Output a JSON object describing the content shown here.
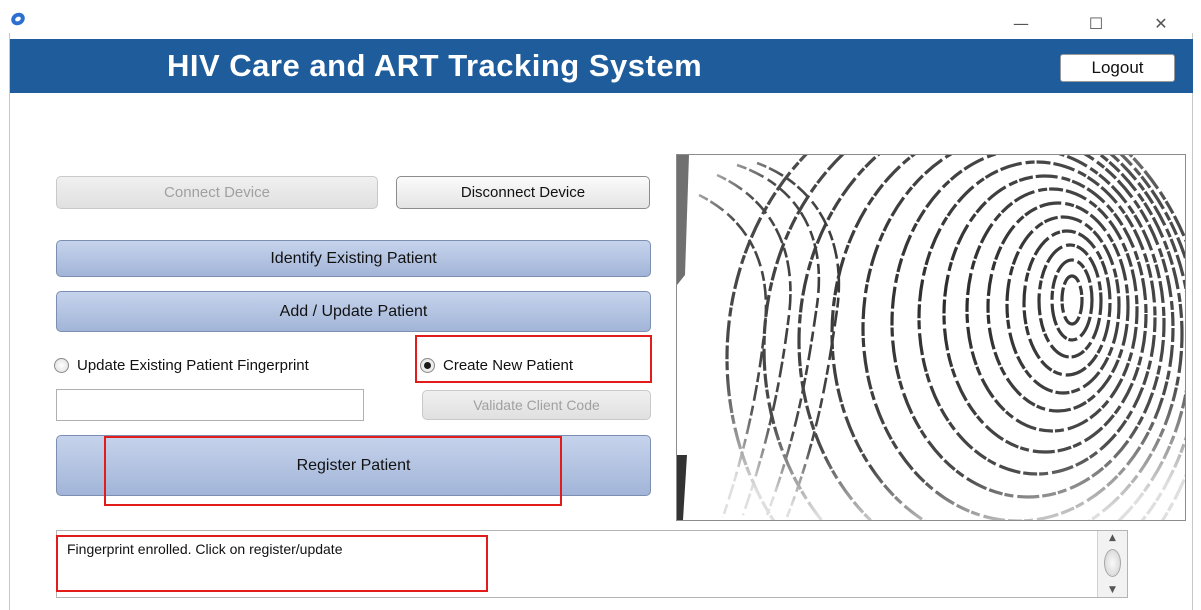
{
  "window": {
    "app_icon": "app-icon",
    "controls": {
      "minimize": "—",
      "maximize": "☐",
      "close": "✕"
    }
  },
  "header": {
    "title": "HIV Care and ART Tracking System",
    "logout_label": "Logout",
    "background_color": "#1f5c9b"
  },
  "device": {
    "connect_label": "Connect Device",
    "connect_enabled": false,
    "disconnect_label": "Disconnect Device"
  },
  "actions": {
    "identify_label": "Identify Existing Patient",
    "add_update_label": "Add / Update Patient",
    "register_label": "Register Patient"
  },
  "mode": {
    "options": [
      {
        "label": "Update Existing Patient Fingerprint",
        "selected": false
      },
      {
        "label": "Create New Patient",
        "selected": true
      }
    ]
  },
  "client_code": {
    "value": "",
    "placeholder": "",
    "validate_label": "Validate Client Code",
    "validate_enabled": false
  },
  "fingerprint": {
    "icon": "fingerprint-image"
  },
  "status": {
    "message": "Fingerprint enrolled. Click on register/update"
  },
  "highlight_color": "#e21b1b"
}
